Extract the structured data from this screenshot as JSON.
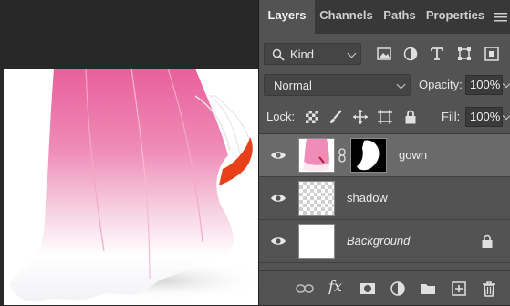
{
  "tabs": [
    {
      "label": "Layers",
      "active": true
    },
    {
      "label": "Channels",
      "active": false
    },
    {
      "label": "Paths",
      "active": false
    },
    {
      "label": "Properties",
      "active": false
    }
  ],
  "filter": {
    "kind_label": "Kind",
    "icons": [
      "image-filter-icon",
      "adjustment-filter-icon",
      "type-filter-icon",
      "shape-filter-icon",
      "smart-object-filter-icon"
    ]
  },
  "blend": {
    "mode": "Normal",
    "opacity_label": "Opacity:",
    "opacity_value": "100%"
  },
  "lock": {
    "label": "Lock:",
    "fill_label": "Fill:",
    "fill_value": "100%"
  },
  "layers": [
    {
      "name": "gown",
      "selected": true,
      "visible": true,
      "has_mask": true
    },
    {
      "name": "shadow",
      "selected": false,
      "visible": true,
      "has_mask": false
    },
    {
      "name": "Background",
      "selected": false,
      "visible": true,
      "locked": true
    }
  ],
  "footer_tools": [
    "link-layers-icon",
    "fx-icon",
    "add-mask-icon",
    "adjustment-layer-icon",
    "new-group-icon",
    "new-layer-icon",
    "delete-layer-icon"
  ],
  "footer": {
    "fx_label": "fx"
  },
  "colors": {
    "panel": "#535353",
    "selected_layer": "#6a6a6a",
    "gown_pink": "#e8609a",
    "shoe_red": "#e8401a"
  }
}
